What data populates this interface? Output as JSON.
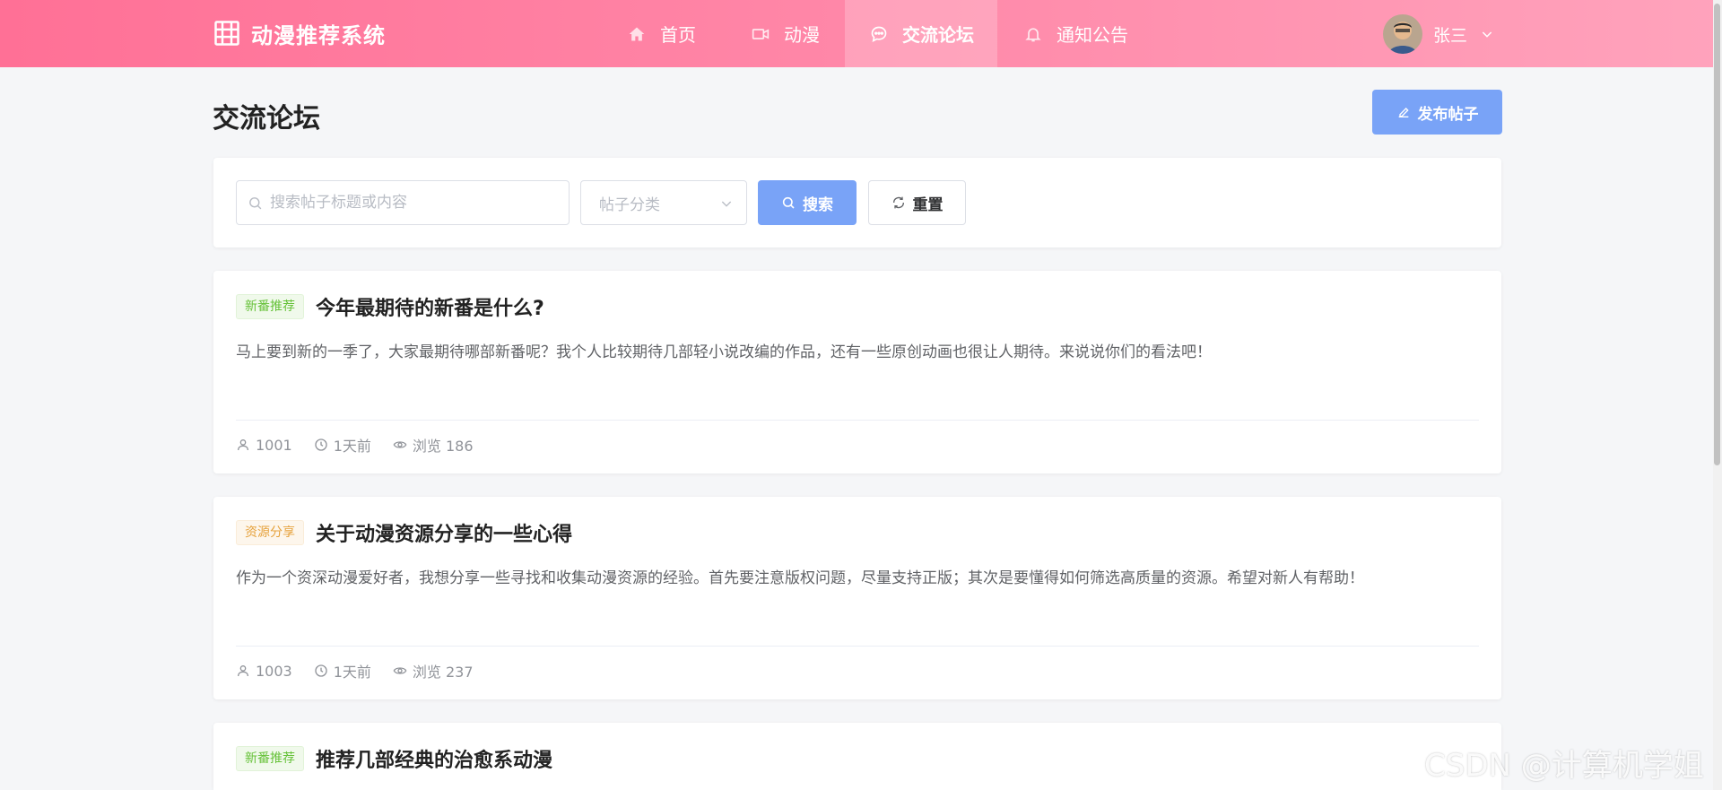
{
  "app": {
    "title": "动漫推荐系统",
    "logo_icon": "film-grid-icon",
    "accent_color": "#ff7096"
  },
  "nav": {
    "items": [
      {
        "label": "首页",
        "icon": "home-icon"
      },
      {
        "label": "动漫",
        "icon": "video-icon"
      },
      {
        "label": "交流论坛",
        "icon": "chat-icon",
        "active": true
      },
      {
        "label": "通知公告",
        "icon": "bell-icon"
      }
    ]
  },
  "user": {
    "name": "张三",
    "avatar": "user-avatar"
  },
  "page": {
    "title": "交流论坛",
    "publish_label": "发布帖子"
  },
  "search": {
    "placeholder": "搜索帖子标题或内容",
    "category_placeholder": "帖子分类",
    "search_label": "搜索",
    "reset_label": "重置",
    "primary_color": "#79a3f7"
  },
  "posts": [
    {
      "tag": "新番推荐",
      "tag_color": "green",
      "title": "今年最期待的新番是什么?",
      "content": "马上要到新的一季了，大家最期待哪部新番呢？我个人比较期待几部轻小说改编的作品，还有一些原创动画也很让人期待。来说说你们的看法吧！",
      "author": "1001",
      "time": "1天前",
      "views": "浏览 186"
    },
    {
      "tag": "资源分享",
      "tag_color": "orange",
      "title": "关于动漫资源分享的一些心得",
      "content": "作为一个资深动漫爱好者，我想分享一些寻找和收集动漫资源的经验。首先要注意版权问题，尽量支持正版；其次是要懂得如何筛选高质量的资源。希望对新人有帮助！",
      "author": "1003",
      "time": "1天前",
      "views": "浏览 237"
    },
    {
      "tag": "新番推荐",
      "tag_color": "green",
      "title": "推荐几部经典的治愈系动漫"
    }
  ],
  "watermark": "CSDN @计算机学姐"
}
